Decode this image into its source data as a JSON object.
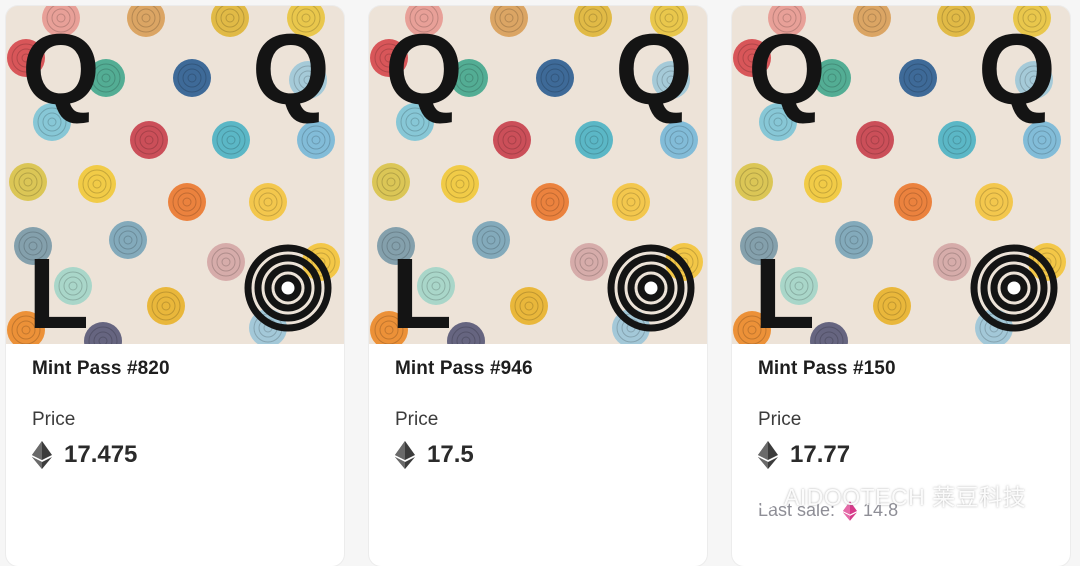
{
  "cards": [
    {
      "art_letters": [
        "Q",
        "Q",
        "L"
      ],
      "name": "Mint Pass #820",
      "price_label": "Price",
      "price": "17.475",
      "currency_icon": "ethereum-icon"
    },
    {
      "art_letters": [
        "Q",
        "Q",
        "L"
      ],
      "name": "Mint Pass #946",
      "price_label": "Price",
      "price": "17.5",
      "currency_icon": "ethereum-icon"
    },
    {
      "art_letters": [
        "Q",
        "Q",
        "L"
      ],
      "name": "Mint Pass #150",
      "price_label": "Price",
      "price": "17.77",
      "currency_icon": "ethereum-icon",
      "last_sale_label": "Last sale:",
      "last_sale_value": "14.8"
    }
  ],
  "watermark": {
    "text": "AIDOOTECH 莱豆科技",
    "icon": "wechat-icon"
  },
  "colors": {
    "art_background": "#ede3d8",
    "eth_dark": "#343434",
    "eth_pink": "#d63a8a"
  }
}
